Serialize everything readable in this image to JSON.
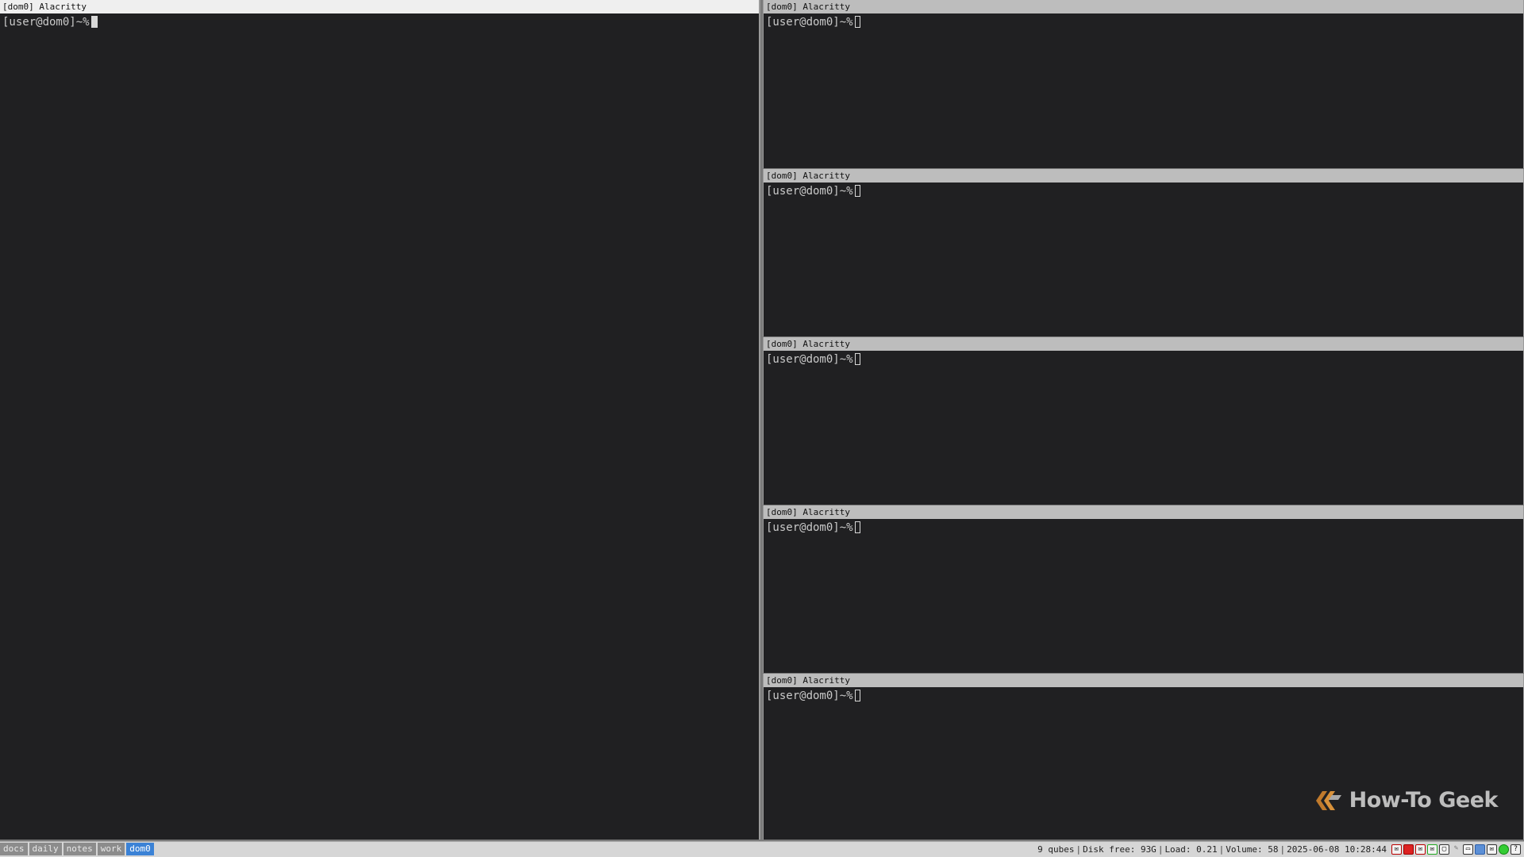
{
  "windows": [
    {
      "id": "main",
      "title": "[dom0] Alacritty",
      "prompt": "[user@dom0]~%",
      "focused": true
    },
    {
      "id": "r1",
      "title": "[dom0] Alacritty",
      "prompt": "[user@dom0]~%",
      "focused": false
    },
    {
      "id": "r2",
      "title": "[dom0] Alacritty",
      "prompt": "[user@dom0]~%",
      "focused": false
    },
    {
      "id": "r3",
      "title": "[dom0] Alacritty",
      "prompt": "[user@dom0]~%",
      "focused": false
    },
    {
      "id": "r4",
      "title": "[dom0] Alacritty",
      "prompt": "[user@dom0]~%",
      "focused": false
    },
    {
      "id": "r5",
      "title": "[dom0] Alacritty",
      "prompt": "[user@dom0]~%",
      "focused": false
    }
  ],
  "workspaces": [
    {
      "label": "docs",
      "active": false
    },
    {
      "label": "daily",
      "active": false
    },
    {
      "label": "notes",
      "active": false
    },
    {
      "label": "work",
      "active": false
    },
    {
      "label": "dom0",
      "active": true
    }
  ],
  "status": {
    "qubes": "9 qubes",
    "disk": "Disk free: 93G",
    "load": "Load: 0.21",
    "volume": "Volume: 58",
    "datetime": "2025-06-08 10:28:44"
  },
  "tray_icons": [
    "mail-icon",
    "network-icon",
    "mail-alert-icon",
    "mail-icon",
    "window-icon",
    "feather-icon",
    "battery-icon",
    "shield-icon",
    "mail-icon",
    "status-dot-icon",
    "help-icon"
  ],
  "watermark": "How-To Geek",
  "colors": {
    "terminal_bg": "#202022",
    "active_workspace": "#3b82d6",
    "focused_title_bg": "#efefef",
    "unfocused_title_bg": "#bdbdbd"
  }
}
